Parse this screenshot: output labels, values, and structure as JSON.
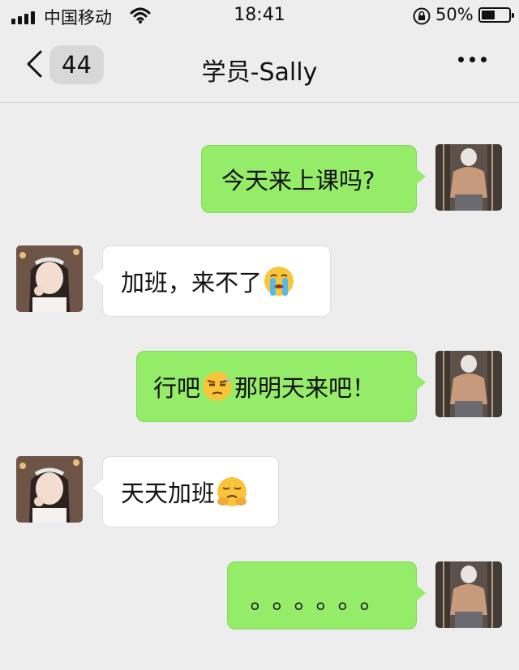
{
  "status_bar": {
    "carrier": "中国移动",
    "time": "18:41",
    "battery_percent": "50%",
    "battery_level": 0.5
  },
  "nav": {
    "unread_count": "44",
    "title": "学员-Sally"
  },
  "messages": [
    {
      "direction": "outgoing",
      "text": "今天来上课吗?"
    },
    {
      "direction": "incoming",
      "text_before": "加班，来不了",
      "emoji": "loudly-crying-face"
    },
    {
      "direction": "outgoing",
      "text_before": "行吧",
      "emoji": "unamused-sweat-face",
      "text_after": "那明天来吧！"
    },
    {
      "direction": "incoming",
      "text_before": "天天加班",
      "emoji": "tired-face"
    },
    {
      "direction": "outgoing",
      "text": "。。。。。。"
    }
  ],
  "colors": {
    "background": "#ededed",
    "outgoing_bubble": "#95ec69",
    "incoming_bubble": "#ffffff"
  }
}
